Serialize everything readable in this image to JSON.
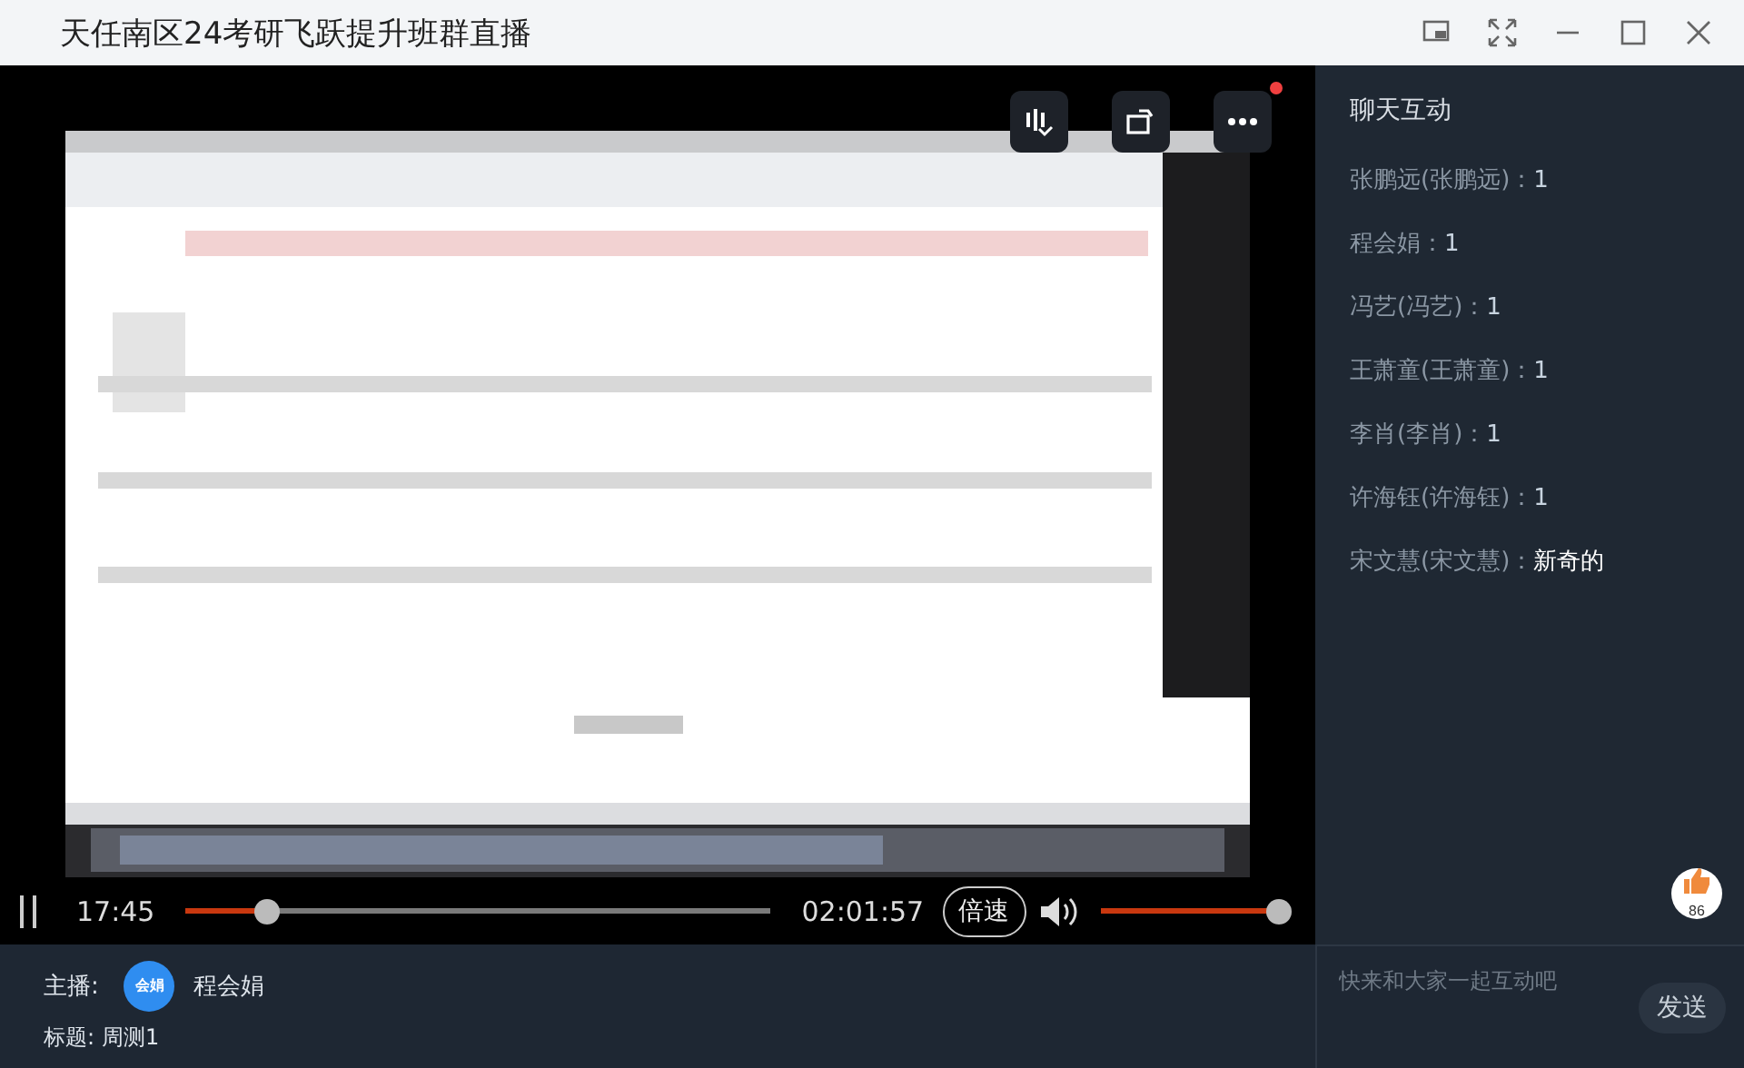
{
  "window": {
    "title": "天任南区24考研飞跃提升班群直播"
  },
  "player": {
    "alert": true,
    "playing": true,
    "elapsed": "17:45",
    "level": 0.14,
    "duration": "02:01:57",
    "speed_button": "倍速",
    "volume": {
      "level": 1
    }
  },
  "like": {
    "count": "86"
  },
  "chat": {
    "title": "聊天互动",
    "messages": [
      {
        "sender": "张鹏远(张鹏远)：",
        "text": "1"
      },
      {
        "sender": "程会娟：",
        "text": "1"
      },
      {
        "sender": "冯艺(冯艺)：",
        "text": "1"
      },
      {
        "sender": "王萧童(王萧童)：",
        "text": "1"
      },
      {
        "sender": "李肖(李肖)：",
        "text": "1"
      },
      {
        "sender": "许海钰(许海钰)：",
        "text": "1"
      },
      {
        "sender": "宋文慧(宋文慧)：",
        "text": "新奇的"
      }
    ]
  },
  "host": {
    "label": "主播:",
    "avatar": "会娟",
    "name": "程会娟"
  },
  "topic": {
    "label": "标题:",
    "value": "周测1"
  },
  "composer": {
    "placeholder": "快来和大家一起互动吧",
    "send": "发送"
  }
}
